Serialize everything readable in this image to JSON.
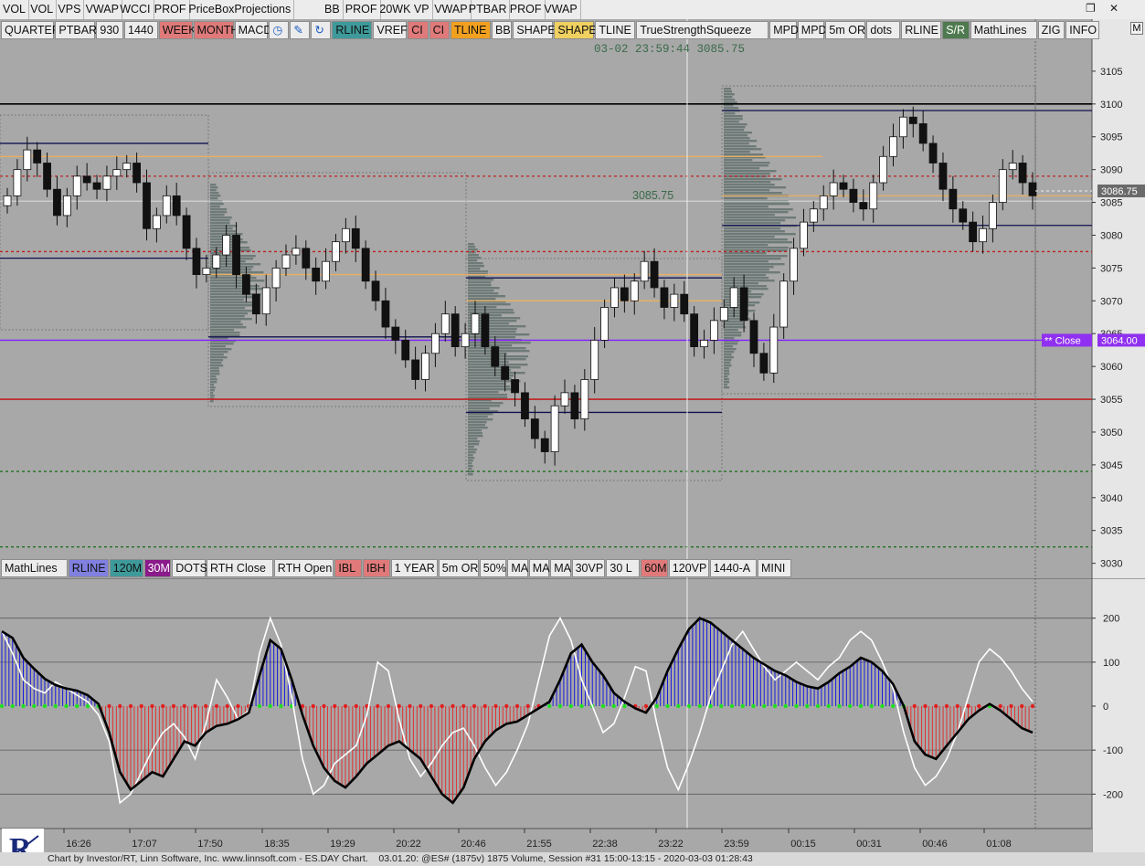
{
  "app": {
    "top_tabs": [
      "VOL",
      "VOL",
      "VPS",
      "VWAP",
      "WCCI",
      "PROF",
      "PriceBoxProjections",
      "BB",
      "PROF",
      "20WK VP",
      "VWAP",
      "PTBAR",
      "PROF",
      "VWAP"
    ],
    "window_controls": {
      "restore": "❐",
      "close": "✕"
    }
  },
  "toolbar_top": [
    {
      "label": "QUARTER",
      "bg": "#ececec"
    },
    {
      "label": "PTBAR",
      "bg": "#ececec"
    },
    {
      "label": "930",
      "bg": "#ececec"
    },
    {
      "label": "1440",
      "bg": "#ececec"
    },
    {
      "label": "WEEK",
      "bg": "#e07a7a"
    },
    {
      "label": "MONTH",
      "bg": "#e07a7a"
    },
    {
      "label": "MACD",
      "bg": "#ececec"
    },
    {
      "label": "clock-icon",
      "icon": true,
      "bg": "#ececec"
    },
    {
      "label": "pencil-icon",
      "icon": true,
      "bg": "#ececec"
    },
    {
      "label": "refresh-icon",
      "icon": true,
      "bg": "#ececec"
    },
    {
      "label": "RLINE",
      "bg": "#3e9a9a"
    },
    {
      "label": "VREF",
      "bg": "#ececec"
    },
    {
      "label": "CI",
      "bg": "#e07a7a"
    },
    {
      "label": "CI",
      "bg": "#e07a7a"
    },
    {
      "label": "TLINE",
      "bg": "#f2a020"
    },
    {
      "label": "BB",
      "bg": "#ececec"
    },
    {
      "label": "SHAPE",
      "bg": "#ececec"
    },
    {
      "label": "SHAPE",
      "bg": "#efd060"
    },
    {
      "label": "TLINE",
      "bg": "#ececec"
    },
    {
      "label": "TrueStrengthSqueeze",
      "bg": "#ececec"
    },
    {
      "label": "MPD",
      "bg": "#ececec"
    },
    {
      "label": "MPD",
      "bg": "#ececec"
    },
    {
      "label": "5m OR",
      "bg": "#ececec"
    },
    {
      "label": "dots",
      "bg": "#ececec"
    },
    {
      "label": "RLINE",
      "bg": "#ececec"
    },
    {
      "label": "S/R",
      "bg": "#4f7a4f"
    },
    {
      "label": "MathLines",
      "bg": "#ececec"
    },
    {
      "label": "ZIG",
      "bg": "#ececec"
    },
    {
      "label": "INFO",
      "bg": "#ececec"
    }
  ],
  "toolbar_bottom": [
    {
      "label": "MathLines",
      "bg": "#ececec"
    },
    {
      "label": "RLINE",
      "bg": "#8080e0"
    },
    {
      "label": "120M",
      "bg": "#3e9a9a"
    },
    {
      "label": "30M",
      "bg": "#8a1a8a"
    },
    {
      "label": "DOTS",
      "bg": "#ececec"
    },
    {
      "label": "RTH Close",
      "bg": "#ececec"
    },
    {
      "label": "RTH Open",
      "bg": "#ececec"
    },
    {
      "label": "IBL",
      "bg": "#e07a7a"
    },
    {
      "label": "IBH",
      "bg": "#e07a7a"
    },
    {
      "label": "1 YEAR",
      "bg": "#ececec"
    },
    {
      "label": "5m OR",
      "bg": "#ececec"
    },
    {
      "label": "50%",
      "bg": "#ececec"
    },
    {
      "label": "MA",
      "bg": "#ececec"
    },
    {
      "label": "MA",
      "bg": "#ececec"
    },
    {
      "label": "MA",
      "bg": "#ececec"
    },
    {
      "label": "30VP",
      "bg": "#ececec"
    },
    {
      "label": "30 L",
      "bg": "#ececec"
    },
    {
      "label": "60M",
      "bg": "#e07a7a"
    },
    {
      "label": "120VP",
      "bg": "#ececec"
    },
    {
      "label": "1440-A",
      "bg": "#ececec"
    },
    {
      "label": "MINI",
      "bg": "#ececec"
    }
  ],
  "chart_data": [
    {
      "type": "candlestick",
      "title": "",
      "crosshair_label": "03-02 23:59:44  3085.75",
      "cursor_price_label": "3085.75",
      "last_price_label": "3086.75",
      "close_label": "**  Close",
      "close_value_label": "3064.00",
      "y_ticks": [
        "3030",
        "3035",
        "3040",
        "3045",
        "3050",
        "3055",
        "3060",
        "3065",
        "3070",
        "3075",
        "3080",
        "3085",
        "3090",
        "3095",
        "3100",
        "3105"
      ],
      "ylim": [
        3028,
        3110
      ],
      "x_ticks": [
        "16:26",
        "17:07",
        "17:50",
        "18:35",
        "19:29",
        "20:22",
        "20:46",
        "21:55",
        "22:38",
        "23:22",
        "23:59",
        "00:15",
        "00:31",
        "00:46",
        "01:08"
      ],
      "crosshair_time": "23:59",
      "close_series": [
        3086,
        3090,
        3093,
        3091,
        3087,
        3083,
        3086,
        3089,
        3088,
        3087,
        3089,
        3090,
        3091,
        3088,
        3081,
        3083,
        3086,
        3083,
        3078,
        3074,
        3075,
        3077,
        3080,
        3074,
        3071,
        3068,
        3072,
        3075,
        3077,
        3078,
        3075,
        3073,
        3076,
        3079,
        3081,
        3078,
        3073,
        3070,
        3066,
        3064,
        3061,
        3058,
        3062,
        3065,
        3068,
        3063,
        3065,
        3068,
        3063,
        3060,
        3058,
        3056,
        3052,
        3049,
        3047,
        3054,
        3056,
        3052,
        3058,
        3064,
        3069,
        3072,
        3070,
        3073,
        3076,
        3072,
        3069,
        3071,
        3068,
        3063,
        3064,
        3067,
        3069,
        3072,
        3067,
        3062,
        3059,
        3066,
        3073,
        3078,
        3082,
        3084,
        3086,
        3088,
        3087,
        3085,
        3084,
        3088,
        3092,
        3095,
        3098,
        3097,
        3094,
        3091,
        3087,
        3084,
        3082,
        3079,
        3081,
        3085,
        3090,
        3091,
        3088,
        3086
      ],
      "horizontal_levels": [
        {
          "price": 3100.0,
          "color": "#000000"
        },
        {
          "price": 3099.0,
          "color": "#101050"
        },
        {
          "price": 3094.0,
          "color": "#101050"
        },
        {
          "price": 3092.0,
          "color": "#e8b060"
        },
        {
          "price": 3086.0,
          "color": "#e8b060"
        },
        {
          "price": 3089.0,
          "color": "#c02020"
        },
        {
          "price": 3081.5,
          "color": "#101050"
        },
        {
          "price": 3077.5,
          "color": "#c02020"
        },
        {
          "price": 3076.5,
          "color": "#101050"
        },
        {
          "price": 3074.0,
          "color": "#e8b060"
        },
        {
          "price": 3073.5,
          "color": "#101050"
        },
        {
          "price": 3070.0,
          "color": "#e8b060"
        },
        {
          "price": 3064.0,
          "color": "#8020ff"
        },
        {
          "price": 3064.5,
          "color": "#101050"
        },
        {
          "price": 3055.0,
          "color": "#c02020"
        },
        {
          "price": 3053.0,
          "color": "#101050"
        },
        {
          "price": 3044.0,
          "color": "#207020"
        },
        {
          "price": 3032.5,
          "color": "#207020"
        }
      ]
    },
    {
      "type": "line",
      "title": "",
      "y_ticks": [
        "200",
        "100",
        "0",
        "-100",
        "-200"
      ],
      "ylim": [
        -270,
        270
      ],
      "x_ticks": [
        "16:26",
        "17:07",
        "17:50",
        "18:35",
        "19:29",
        "20:22",
        "20:46",
        "21:55",
        "22:38",
        "23:22",
        "23:59",
        "00:15",
        "00:31",
        "00:46",
        "01:08"
      ],
      "series": [
        {
          "values": [
            170,
            155,
            110,
            85,
            62,
            48,
            40,
            35,
            25,
            5,
            -60,
            -150,
            -190,
            -170,
            -150,
            -160,
            -120,
            -80,
            -90,
            -60,
            -45,
            -40,
            -30,
            -15,
            70,
            150,
            130,
            60,
            -20,
            -90,
            -140,
            -170,
            -185,
            -160,
            -130,
            -110,
            -90,
            -80,
            -100,
            -120,
            -160,
            -200,
            -220,
            -185,
            -120,
            -80,
            -55,
            -40,
            -35,
            -20,
            -5,
            10,
            60,
            120,
            140,
            100,
            70,
            30,
            10,
            -5,
            -15,
            20,
            80,
            130,
            175,
            200,
            190,
            170,
            150,
            130,
            110,
            95,
            80,
            70,
            55,
            45,
            40,
            55,
            75,
            90,
            110,
            100,
            80,
            50,
            0,
            -80,
            -110,
            -120,
            -90,
            -60,
            -30,
            -10,
            5,
            -10,
            -30,
            -50,
            -60
          ]
        },
        {
          "values": [
            170,
            120,
            60,
            40,
            30,
            55,
            40,
            25,
            10,
            -20,
            -80,
            -220,
            -200,
            -150,
            -100,
            -60,
            -40,
            -70,
            -120,
            -40,
            60,
            20,
            -30,
            -10,
            120,
            200,
            140,
            20,
            -120,
            -200,
            -180,
            -130,
            -110,
            -90,
            -20,
            100,
            80,
            -30,
            -120,
            -160,
            -130,
            -90,
            -60,
            -50,
            -90,
            -140,
            -180,
            -150,
            -100,
            -40,
            60,
            160,
            200,
            150,
            60,
            0,
            -60,
            -40,
            20,
            90,
            80,
            -40,
            -140,
            -190,
            -130,
            -60,
            20,
            80,
            140,
            170,
            130,
            90,
            60,
            80,
            100,
            80,
            60,
            90,
            110,
            150,
            170,
            150,
            100,
            40,
            -60,
            -140,
            -180,
            -160,
            -120,
            -60,
            20,
            100,
            130,
            110,
            80,
            40,
            10
          ]
        }
      ]
    }
  ]
}
